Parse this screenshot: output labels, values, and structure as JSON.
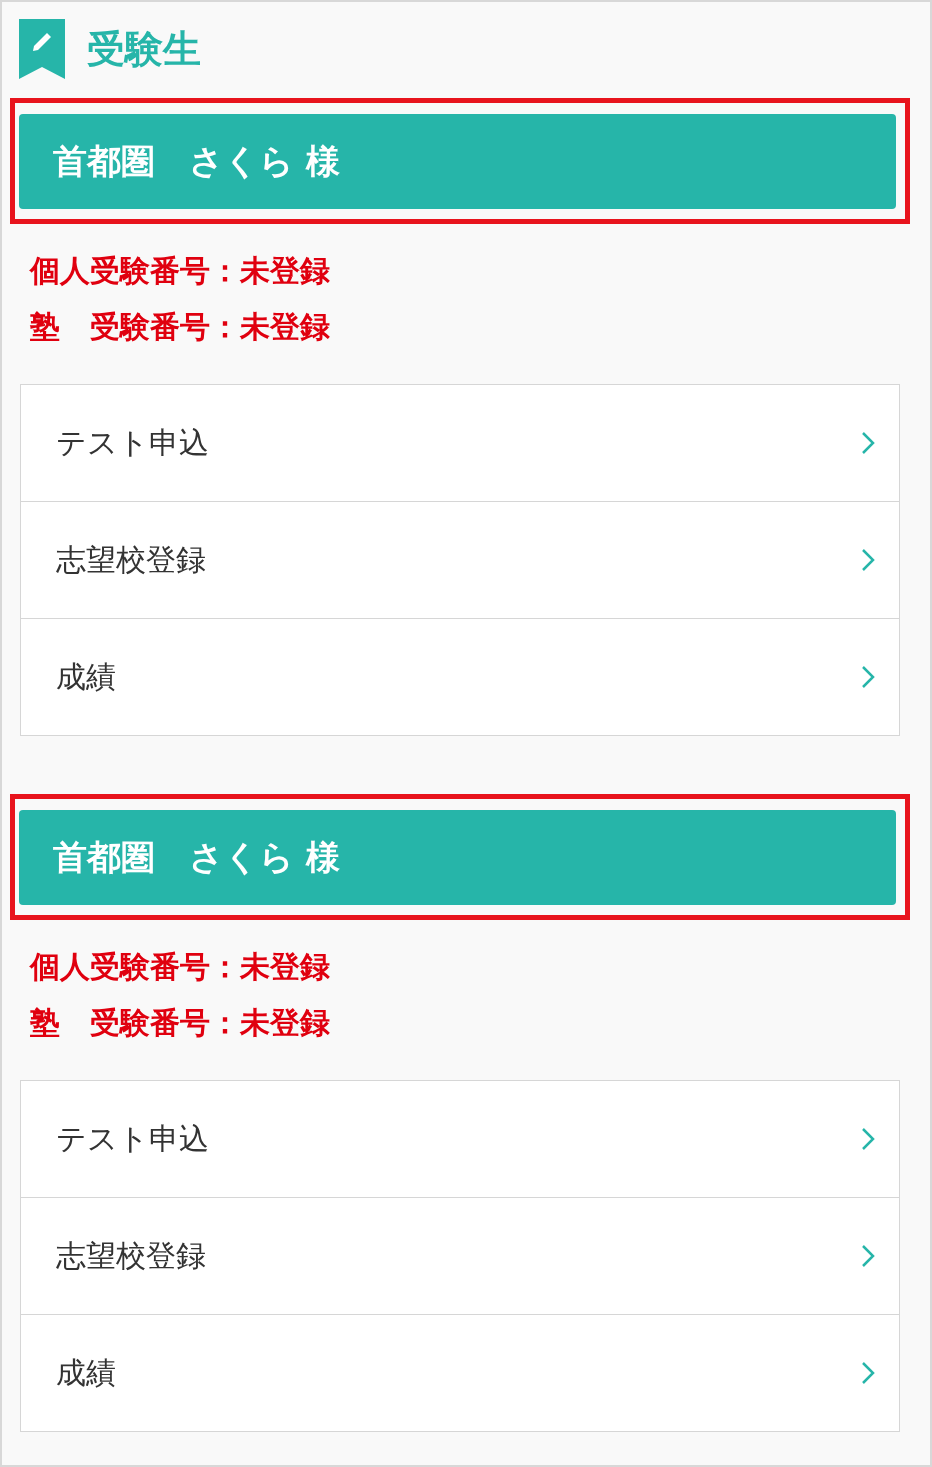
{
  "section": {
    "title": "受験生"
  },
  "students": [
    {
      "name": "首都圏　さくら 様",
      "highlighted": true,
      "ids": [
        "個人受験番号：未登録",
        "塾　受験番号：未登録"
      ],
      "menu": [
        "テスト申込",
        "志望校登録",
        "成績"
      ]
    },
    {
      "name": "首都圏　さくら 様",
      "highlighted": true,
      "ids": [
        "個人受験番号：未登録",
        "塾　受験番号：未登録"
      ],
      "menu": [
        "テスト申込",
        "志望校登録",
        "成績"
      ]
    }
  ]
}
